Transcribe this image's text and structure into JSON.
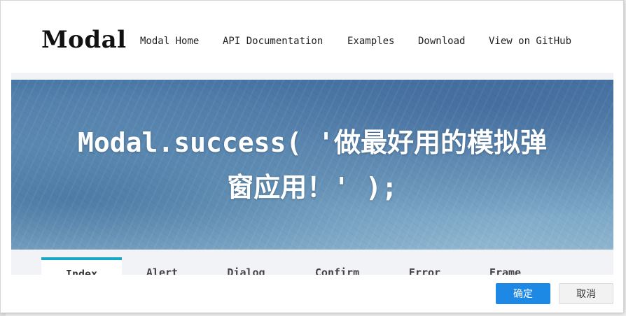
{
  "nav": {
    "brand": "Modal",
    "links": [
      "Modal Home",
      "API Documentation",
      "Examples",
      "Download",
      "View on GitHub"
    ]
  },
  "hero": {
    "line1": "Modal.success( '做最好用的模拟弹",
    "line2": "窗应用！' );"
  },
  "tabs": [
    "Index",
    "Alert",
    "Dialog",
    "Confirm",
    "Error",
    "Frame"
  ],
  "active_tab": "Index",
  "footer": {
    "ok_label": "确定",
    "cancel_label": "取消"
  },
  "colors": {
    "accent": "#18a7c4",
    "primary_button": "#1e88e5"
  }
}
